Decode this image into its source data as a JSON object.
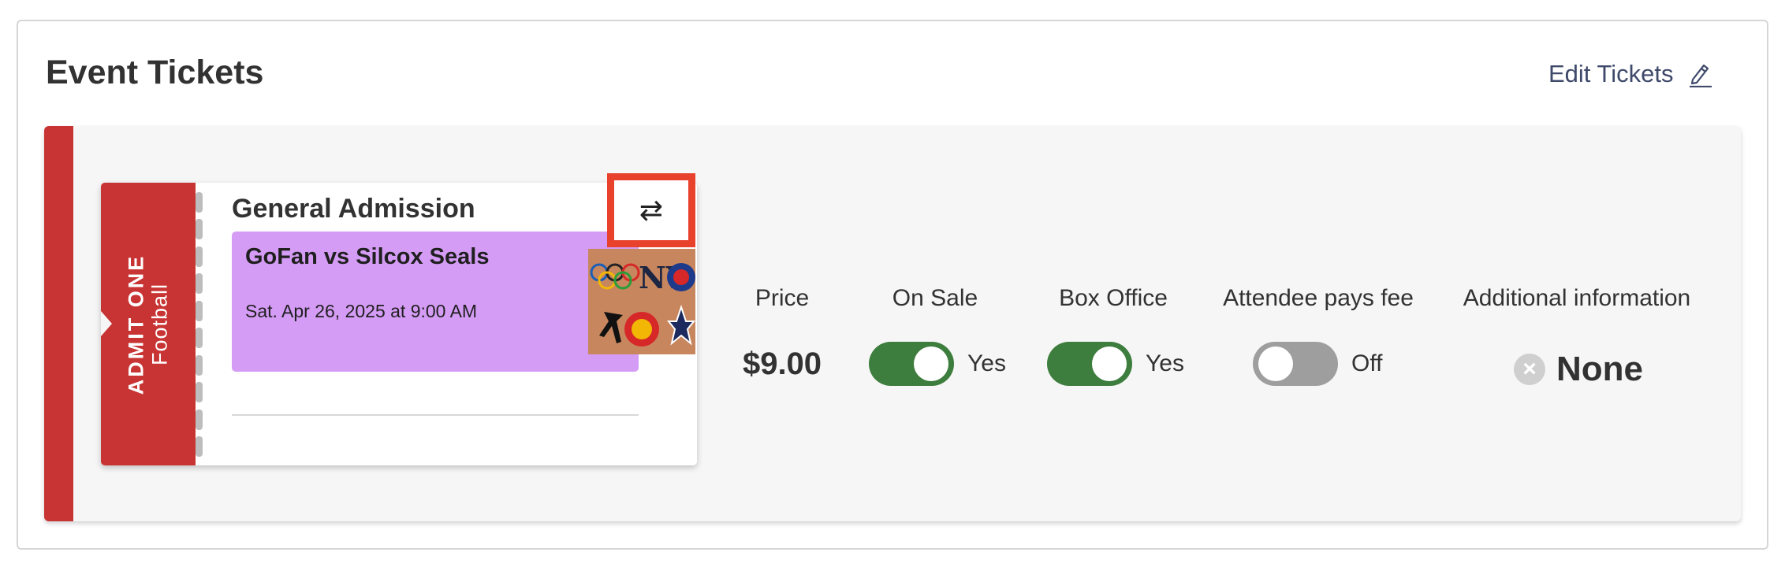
{
  "header": {
    "title": "Event Tickets",
    "edit_label": "Edit Tickets"
  },
  "ticket": {
    "stub_admit": "ADMIT ONE",
    "stub_sport": "Football",
    "type_label": "General Admission",
    "event_name": "GoFan vs Silcox Seals",
    "event_date": "Sat. Apr 26, 2025 at 9:00 AM",
    "event_color": "#d59cf5",
    "swap_icon": "swap-arrows-icon",
    "swap_glyph": "⇄"
  },
  "details": {
    "price_label": "Price",
    "price_value": "$9.00",
    "on_sale_label": "On Sale",
    "on_sale_value": "Yes",
    "on_sale_state": true,
    "box_office_label": "Box Office",
    "box_office_value": "Yes",
    "box_office_state": true,
    "attendee_fee_label": "Attendee pays fee",
    "attendee_fee_value": "Off",
    "attendee_fee_state": false,
    "additional_info_label": "Additional information",
    "additional_info_value": "None"
  },
  "colors": {
    "accent_red": "#c83434",
    "toggle_on": "#3d7d3d",
    "toggle_off": "#9e9e9e",
    "highlight_box": "#e8412c",
    "link": "#3f4a6b"
  }
}
